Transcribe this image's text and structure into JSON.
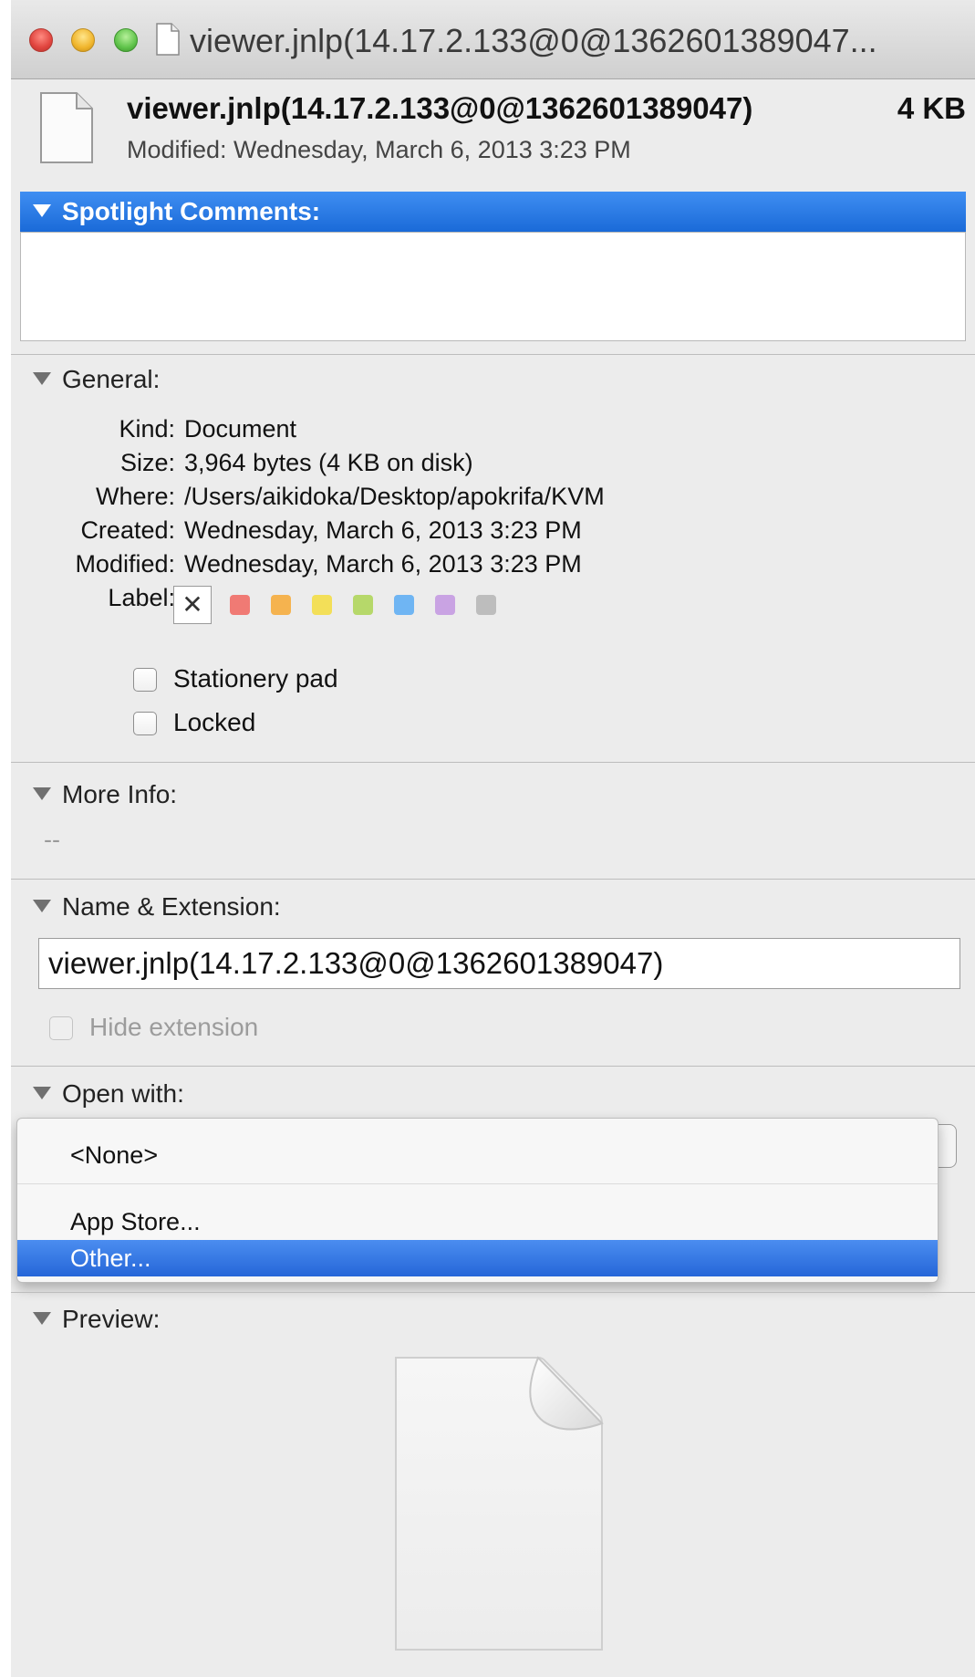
{
  "window": {
    "title": "viewer.jnlp(14.17.2.133@0@1362601389047..."
  },
  "header": {
    "filename": "viewer.jnlp(14.17.2.133@0@1362601389047)",
    "size": "4 KB",
    "modified": "Modified: Wednesday, March 6, 2013 3:23 PM"
  },
  "spotlight": {
    "title": "Spotlight Comments:",
    "value": ""
  },
  "general": {
    "title": "General:",
    "kind_label": "Kind:",
    "kind_value": "Document",
    "size_label": "Size:",
    "size_value": "3,964 bytes (4 KB on disk)",
    "where_label": "Where:",
    "where_value": "/Users/aikidoka/Desktop/apokrifa/KVM",
    "created_label": "Created:",
    "created_value": "Wednesday, March 6, 2013 3:23 PM",
    "modified_label": "Modified:",
    "modified_value": "Wednesday, March 6, 2013 3:23 PM",
    "label_label": "Label:",
    "label_none_glyph": "✕",
    "label_colors": [
      "#f07a74",
      "#f5b34f",
      "#f3df58",
      "#b6d86a",
      "#6fb5f3",
      "#c9a3e3",
      "#bdbdbd"
    ],
    "stationery_label": "Stationery pad",
    "locked_label": "Locked"
  },
  "more_info": {
    "title": "More Info:",
    "value": "--"
  },
  "name_extension": {
    "title": "Name & Extension:",
    "value": "viewer.jnlp(14.17.2.133@0@1362601389047)",
    "hide_extension_label": "Hide extension"
  },
  "open_with": {
    "title": "Open with:",
    "menu_items": [
      "<None>",
      "App Store...",
      "Other..."
    ],
    "selected_item": "Other..."
  },
  "preview": {
    "title": "Preview:"
  }
}
